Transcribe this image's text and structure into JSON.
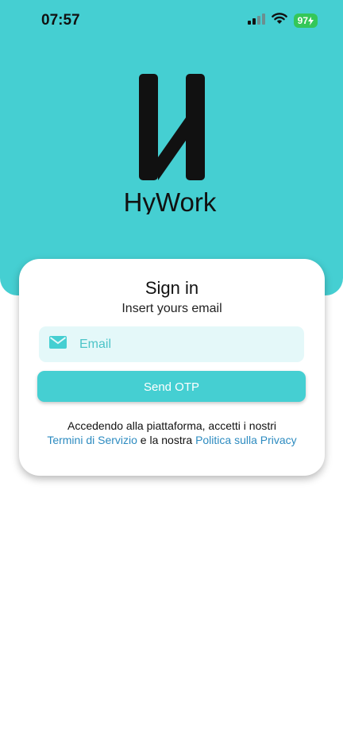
{
  "status_bar": {
    "time": "07:57",
    "battery": "97",
    "icons": [
      "cellular-signal-icon",
      "wifi-icon",
      "battery-charging-icon"
    ]
  },
  "brand": {
    "name": "HyWork",
    "accent_color": "#45CFD2",
    "link_color": "#2D8BC0"
  },
  "signin": {
    "title": "Sign in",
    "subtitle": "Insert yours email",
    "email_placeholder": "Email",
    "email_value": "",
    "send_button": "Send OTP"
  },
  "terms": {
    "prefix": "Accedendo alla piattaforma, accetti i nostri",
    "terms_link": "Termini di Servizio",
    "middle": "e la nostra",
    "privacy_link": "Politica sulla Privacy"
  }
}
